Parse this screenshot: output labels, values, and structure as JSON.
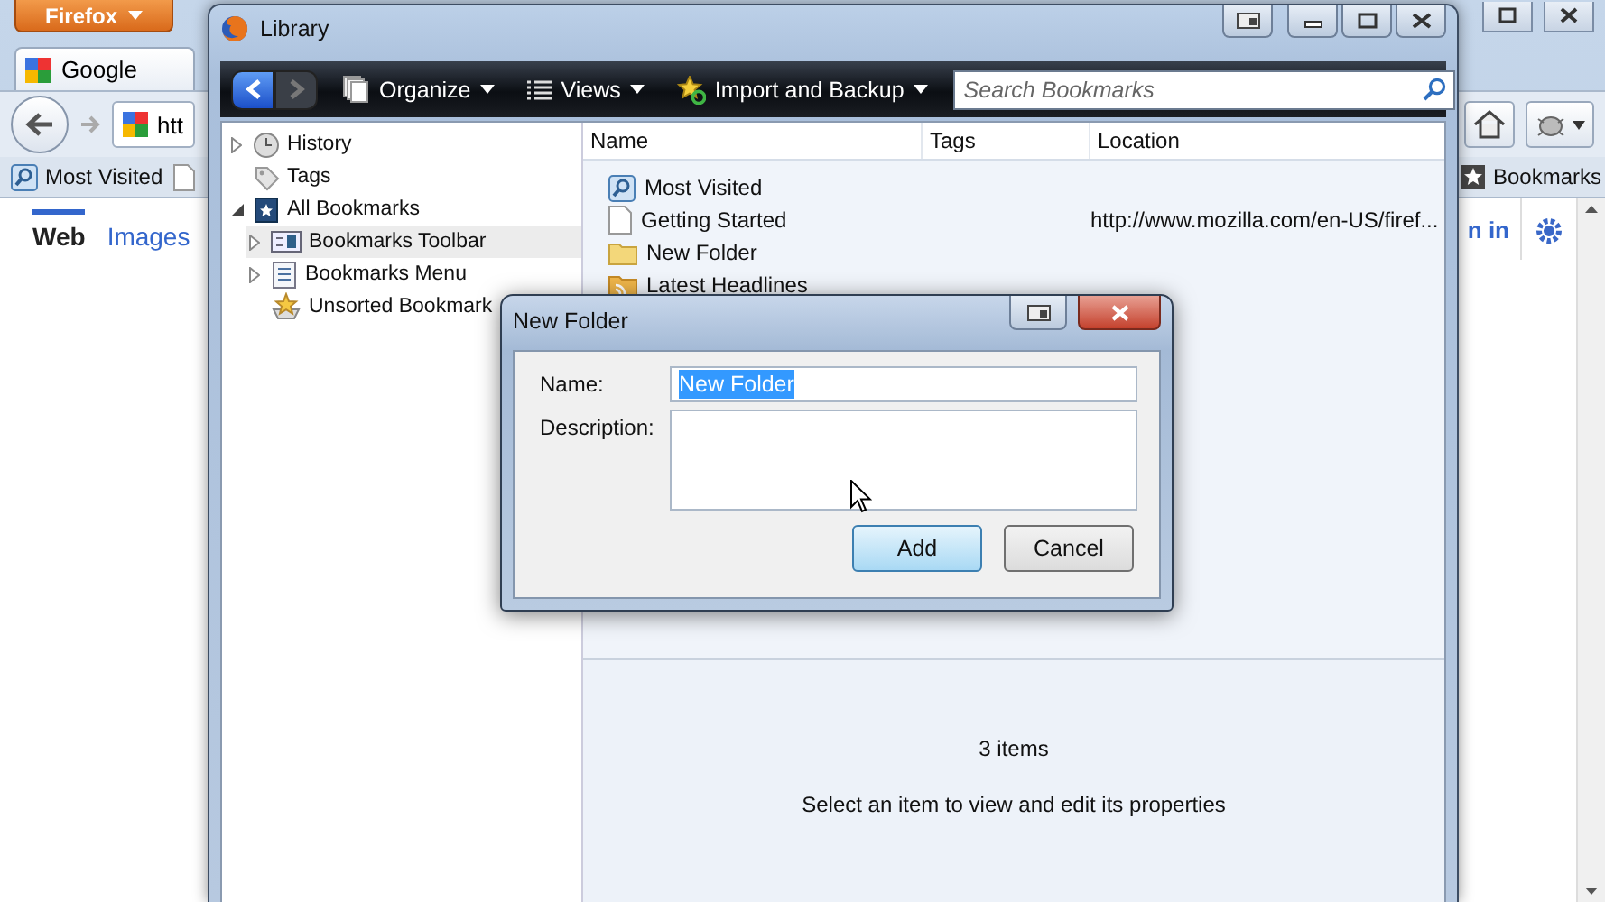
{
  "browser": {
    "menu_button": "Firefox",
    "tab": "Google",
    "address": "htt",
    "bookmarks_bar": [
      {
        "label": "Most Visited",
        "kind": "left"
      },
      {
        "label": "Bookmarks",
        "kind": "right"
      }
    ],
    "search_links": [
      {
        "label": "Web",
        "selected": true
      },
      {
        "label": "Images",
        "selected": false
      }
    ],
    "sign_in": "n in"
  },
  "library": {
    "title": "Library",
    "toolbar": [
      {
        "label": "Organize",
        "kind": "organize"
      },
      {
        "label": "Views",
        "kind": "views"
      },
      {
        "label": "Import and Backup",
        "kind": "import"
      }
    ],
    "search": {
      "placeholder": "Search Bookmarks"
    },
    "tree": [
      {
        "label": "History",
        "kind": "history",
        "expanded": false,
        "selected": false
      },
      {
        "label": "Tags",
        "kind": "tags",
        "selected": false
      },
      {
        "label": "All Bookmarks",
        "kind": "all",
        "expanded": true,
        "selected": false,
        "children": [
          {
            "label": "Bookmarks Toolbar",
            "kind": "toolbar",
            "expanded": false,
            "selected": true
          },
          {
            "label": "Bookmarks Menu",
            "kind": "menu",
            "expanded": false,
            "selected": false
          },
          {
            "label": "Unsorted Bookmark",
            "kind": "unsorted",
            "selected": false
          }
        ]
      }
    ],
    "table": {
      "columns": [
        "Name",
        "Tags",
        "Location"
      ],
      "rows": [
        {
          "kind": "query",
          "name": "Most Visited"
        },
        {
          "kind": "page",
          "name": "Getting Started",
          "location": "http://www.mozilla.com/en-US/firef..."
        },
        {
          "kind": "folder",
          "name": "New Folder"
        },
        {
          "kind": "feed",
          "name": "Latest Headlines"
        }
      ]
    },
    "details": {
      "count": "3 items",
      "hint": "Select an item to view and edit its properties"
    }
  },
  "dialog": {
    "title": "New Folder",
    "fields": [
      {
        "label": "Name:",
        "kind": "line",
        "value": "New Folder"
      },
      {
        "label": "Description:",
        "kind": "area"
      }
    ],
    "buttons": [
      {
        "label": "Add",
        "default": true
      },
      {
        "label": "Cancel",
        "default": false
      }
    ]
  }
}
